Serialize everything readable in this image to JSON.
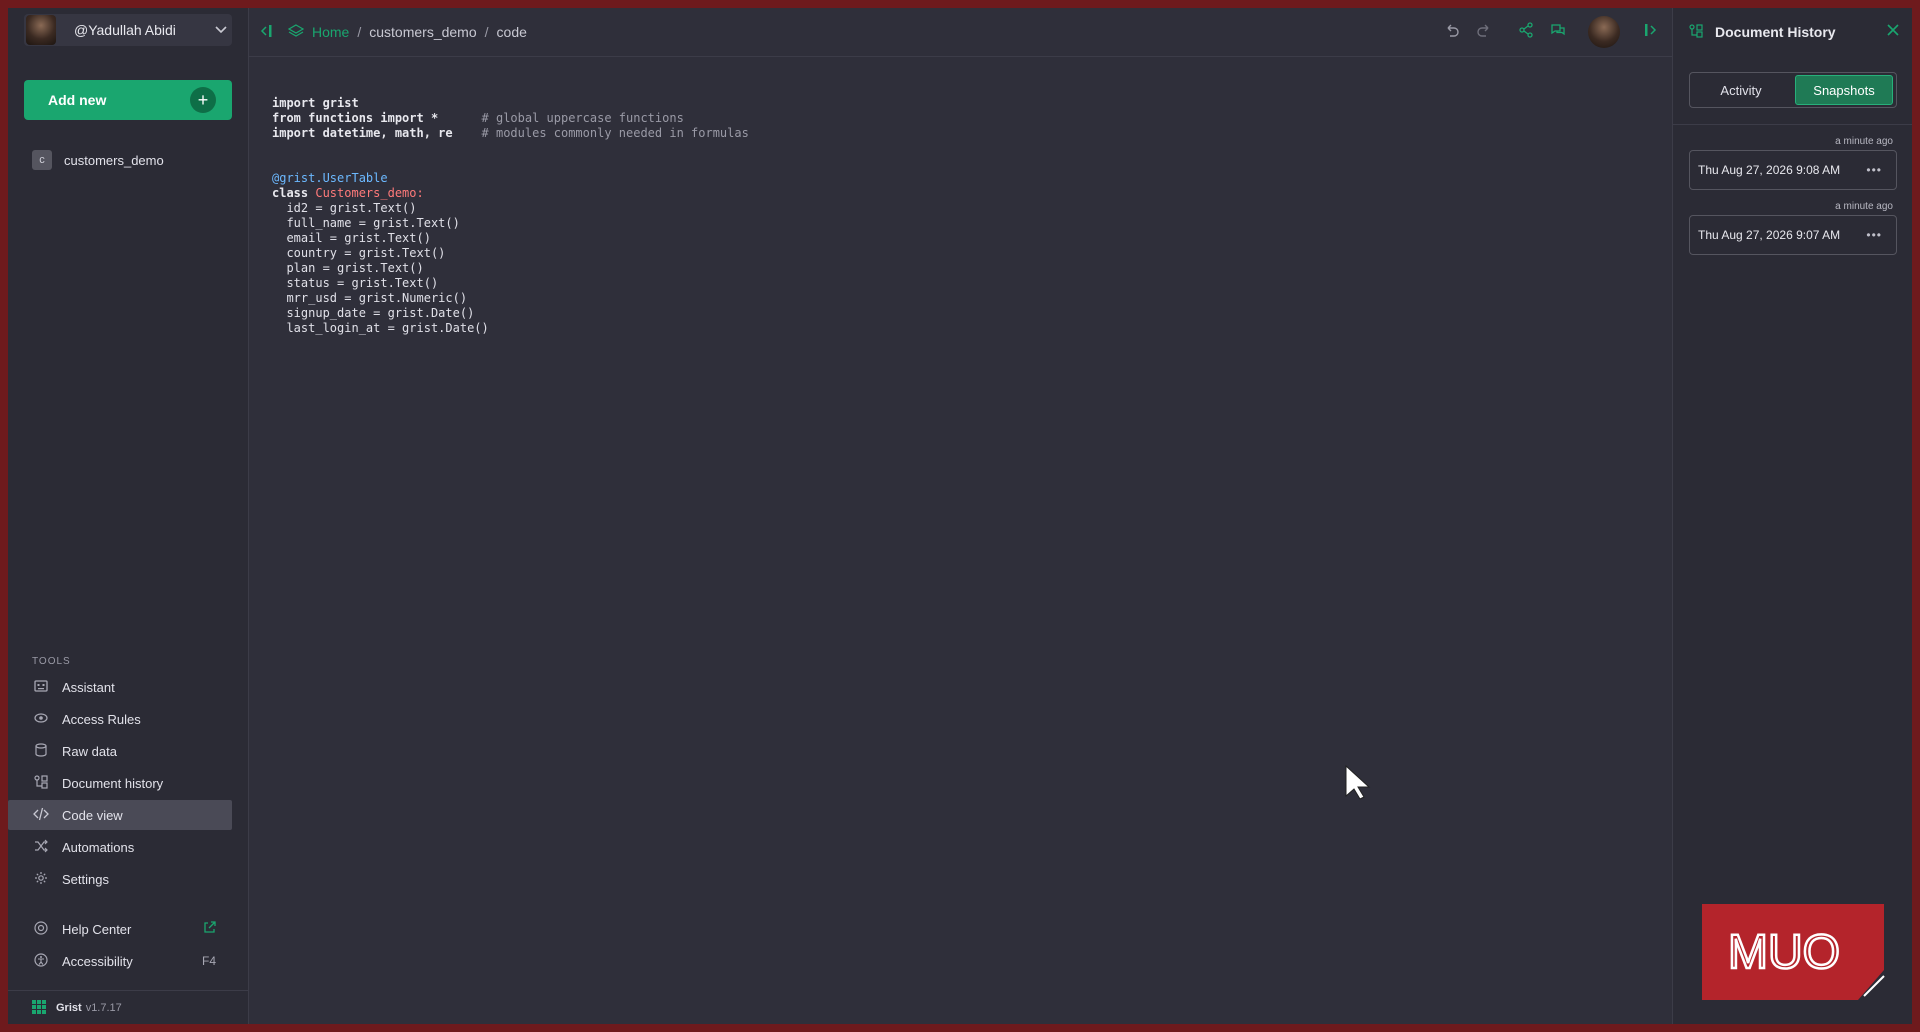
{
  "sidebar": {
    "user_name": "@Yadullah Abidi",
    "add_new_label": "Add new",
    "pages": [
      {
        "letter": "c",
        "label": "customers_demo"
      }
    ],
    "tools_heading": "TOOLS",
    "tools": [
      {
        "label": "Assistant",
        "icon": "assistant-icon"
      },
      {
        "label": "Access Rules",
        "icon": "eye-icon"
      },
      {
        "label": "Raw data",
        "icon": "database-icon"
      },
      {
        "label": "Document history",
        "icon": "history-icon"
      },
      {
        "label": "Code view",
        "icon": "code-icon",
        "active": true
      },
      {
        "label": "Automations",
        "icon": "shuffle-icon"
      },
      {
        "label": "Settings",
        "icon": "gear-icon"
      }
    ],
    "help_center_label": "Help Center",
    "accessibility_label": "Accessibility",
    "accessibility_shortcut": "F4",
    "footer_name": "Grist",
    "footer_version": "v1.7.17"
  },
  "topbar": {
    "breadcrumbs": [
      "Home",
      "customers_demo",
      "code"
    ]
  },
  "code": {
    "header_lines": [
      {
        "code": "import grist",
        "comment": ""
      },
      {
        "code": "from functions import *      ",
        "comment": "# global uppercase functions"
      },
      {
        "code": "import datetime, math, re    ",
        "comment": "# modules commonly needed in formulas"
      }
    ],
    "decorator": "@grist.UserTable",
    "class_keyword": "class",
    "class_name": "Customers_demo",
    "fields": [
      "id2 = grist.Text()",
      "full_name = grist.Text()",
      "email = grist.Text()",
      "country = grist.Text()",
      "plan = grist.Text()",
      "status = grist.Text()",
      "mrr_usd = grist.Numeric()",
      "signup_date = grist.Date()",
      "last_login_at = grist.Date()"
    ]
  },
  "panel": {
    "title": "Document History",
    "tabs": [
      "Activity",
      "Snapshots"
    ],
    "active_tab": "Snapshots",
    "snapshots": [
      {
        "relative": "a minute ago",
        "label": "Thu Aug 27, 2026 9:08 AM"
      },
      {
        "relative": "a minute ago",
        "label": "Thu Aug 27, 2026 9:07 AM"
      }
    ]
  },
  "watermark": {
    "text": "MUO",
    "color": "#b4242b"
  },
  "colors": {
    "accent": "#1aa66f",
    "background": "#2f2f3a"
  }
}
